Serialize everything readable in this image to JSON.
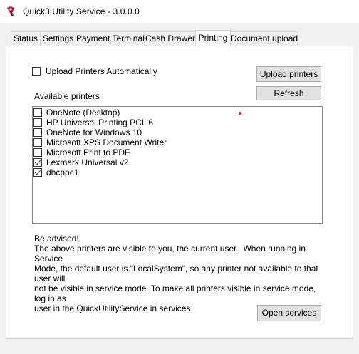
{
  "window": {
    "title": "Quick3 Utility Service - 3.0.0.0",
    "app_icon": "quick3-logo-icon"
  },
  "tabs": [
    {
      "label": "Status"
    },
    {
      "label": "Settings"
    },
    {
      "label": "Payment Terminal"
    },
    {
      "label": "Cash Drawer"
    },
    {
      "label": "Printing",
      "active": true
    },
    {
      "label": "Document upload"
    }
  ],
  "printing": {
    "upload_auto_label": "Upload Printers Automatically",
    "upload_auto_checked": false,
    "upload_printers_button": "Upload printers",
    "refresh_button": "Refresh",
    "available_printers_label": "Available printers",
    "printers": [
      {
        "name": "OneNote (Desktop)",
        "checked": false
      },
      {
        "name": "HP Universal Printing PCL 6",
        "checked": false
      },
      {
        "name": "OneNote for Windows 10",
        "checked": false
      },
      {
        "name": "Microsoft XPS Document Writer",
        "checked": false
      },
      {
        "name": "Microsoft Print to PDF",
        "checked": false
      },
      {
        "name": "Lexmark Universal v2",
        "checked": true
      },
      {
        "name": "dhcppc1",
        "checked": true
      }
    ],
    "advice_text": "Be advised!\nThe above printers are visible to you, the current user.  When running in Service\nMode, the default user is \"LocalSystem\", so any printer not available to that user will\nnot be visible in service mode. To make all printers visible in service mode, log in as\nuser in the QuickUtilityService in services",
    "advice_trailing": ".",
    "open_services_button": "Open services"
  },
  "colors": {
    "accent_red": "#c8102e",
    "marker_dot": "#e02020"
  }
}
